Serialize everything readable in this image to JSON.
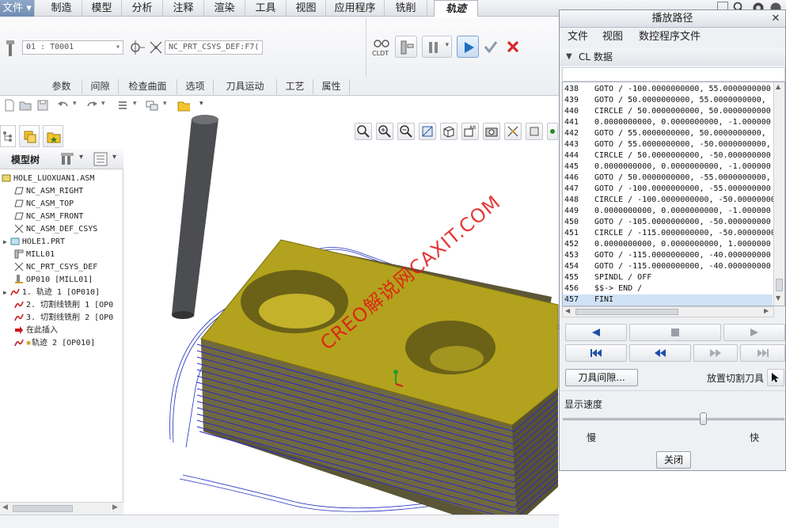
{
  "menu": {
    "file": "文件",
    "tabs": [
      "制造",
      "模型",
      "分析",
      "注释",
      "渲染",
      "工具",
      "视图",
      "应用程序",
      "铣削"
    ],
    "active_tab": "轨迹"
  },
  "ribbon": {
    "tool_combo": "01 : T0001",
    "csys_combo": "NC_PRT_CSYS_DEF:F7(",
    "cldt_label": "CLDT",
    "groups": [
      "参数",
      "间隙",
      "检查曲面",
      "选项",
      "刀具运动",
      "工艺",
      "属性"
    ]
  },
  "left_panel": {
    "tree_title": "模型树",
    "items": [
      {
        "label": "HOLE_LUOXUAN1.ASM",
        "icon": "assembly-icon"
      },
      {
        "label": "NC_ASM_RIGHT",
        "icon": "datum-plane-icon"
      },
      {
        "label": "NC_ASM_TOP",
        "icon": "datum-plane-icon"
      },
      {
        "label": "NC_ASM_FRONT",
        "icon": "datum-plane-icon"
      },
      {
        "label": "NC_ASM_DEF_CSYS",
        "icon": "csys-icon"
      },
      {
        "label": "HOLE1.PRT",
        "icon": "part-icon"
      },
      {
        "label": "MILL01",
        "icon": "workcell-icon"
      },
      {
        "label": "NC_PRT_CSYS_DEF",
        "icon": "csys-icon"
      },
      {
        "label": "OP010 [MILL01]",
        "icon": "operation-icon"
      },
      {
        "label": "1. 轨迹 1 [OP010]",
        "icon": "toolpath-icon"
      },
      {
        "label": "2. 切割线铣削 1 [OP0",
        "icon": "toolpath-icon"
      },
      {
        "label": "3. 切割线铣削 2 [OP0",
        "icon": "toolpath-icon"
      },
      {
        "label": "在此插入",
        "icon": "insert-here-icon"
      },
      {
        "label": "轨迹 2 [OP010]",
        "icon": "toolpath-icon"
      }
    ]
  },
  "viewport": {
    "watermark": "CREO解说网CAXIT.COM"
  },
  "dialog": {
    "title": "播放路径",
    "menu": [
      "文件",
      "视图",
      "数控程序文件"
    ],
    "cl_section": "CL 数据",
    "cl_rows": [
      {
        "n": "438",
        "t": "GOTO / -100.0000000000, 55.0000000000"
      },
      {
        "n": "439",
        "t": "GOTO / 50.0000000000, 55.0000000000,"
      },
      {
        "n": "440",
        "t": "CIRCLE / 50.0000000000, 50.0000000000"
      },
      {
        "n": "441",
        "t": "0.0000000000, 0.0000000000, -1.000000"
      },
      {
        "n": "442",
        "t": "GOTO / 55.0000000000, 50.0000000000,"
      },
      {
        "n": "443",
        "t": "GOTO / 55.0000000000, -50.0000000000,"
      },
      {
        "n": "444",
        "t": "CIRCLE / 50.0000000000, -50.000000000"
      },
      {
        "n": "445",
        "t": "0.0000000000, 0.0000000000, -1.000000"
      },
      {
        "n": "446",
        "t": "GOTO / 50.0000000000, -55.0000000000,"
      },
      {
        "n": "447",
        "t": "GOTO / -100.0000000000, -55.000000000"
      },
      {
        "n": "448",
        "t": "CIRCLE / -100.0000000000, -50.000000000"
      },
      {
        "n": "449",
        "t": "0.0000000000, 0.0000000000, -1.000000"
      },
      {
        "n": "450",
        "t": "GOTO / -105.0000000000, -50.000000000"
      },
      {
        "n": "451",
        "t": "CIRCLE / -115.0000000000, -50.000000000"
      },
      {
        "n": "452",
        "t": "0.0000000000, 0.0000000000, 1.0000000"
      },
      {
        "n": "453",
        "t": "GOTO / -115.0000000000, -40.000000000"
      },
      {
        "n": "454",
        "t": "GOTO / -115.0000000000, -40.000000000"
      },
      {
        "n": "455",
        "t": "SPINDL / OFF"
      },
      {
        "n": "456",
        "t": "$$-> END /"
      },
      {
        "n": "457",
        "t": "FINI"
      }
    ],
    "tool_clearance_btn": "刀具间隙...",
    "place_tool_label": "放置切割刀具",
    "speed_label": "显示速度",
    "speed_slow": "慢",
    "speed_fast": "快",
    "speed_value": 0.64,
    "close_btn": "关闭"
  }
}
